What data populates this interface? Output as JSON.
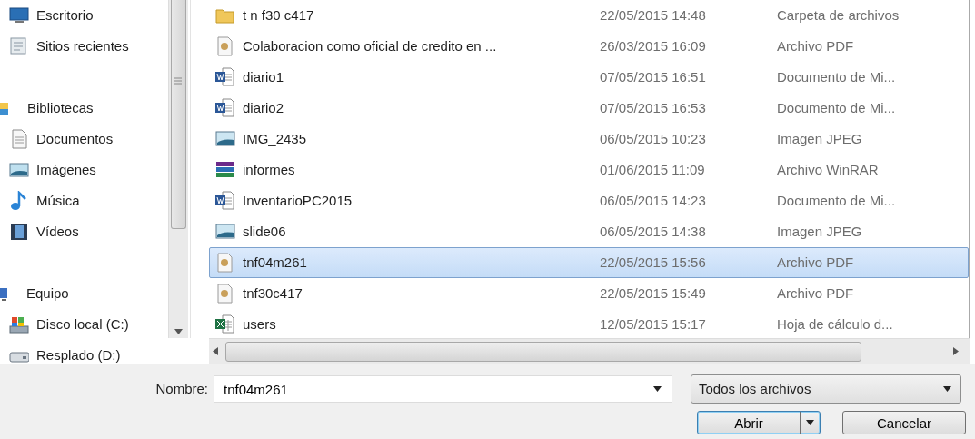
{
  "sidebar": {
    "groups": [
      {
        "children": [
          {
            "label": "Escritorio",
            "kind": "desktop"
          },
          {
            "label": "Sitios recientes",
            "kind": "recent"
          }
        ]
      },
      {
        "label": "Bibliotecas",
        "kind": "library",
        "children": [
          {
            "label": "Documentos",
            "kind": "documents"
          },
          {
            "label": "Imágenes",
            "kind": "pictures"
          },
          {
            "label": "Música",
            "kind": "music"
          },
          {
            "label": "Vídeos",
            "kind": "videos"
          }
        ]
      },
      {
        "label": "Equipo",
        "kind": "computer",
        "children": [
          {
            "label": "Disco local (C:)",
            "kind": "system"
          },
          {
            "label": "Resplado (D:)",
            "kind": "drive"
          }
        ]
      }
    ]
  },
  "files": {
    "rows": [
      {
        "name": "t n f30 c417",
        "date": "22/05/2015 14:48",
        "type": "Carpeta de archivos",
        "kind": "folder",
        "selected": false
      },
      {
        "name": "Colaboracion como oficial de credito en ...",
        "date": "26/03/2015 16:09",
        "type": "Archivo PDF",
        "kind": "pdf",
        "selected": false
      },
      {
        "name": "diario1",
        "date": "07/05/2015 16:51",
        "type": "Documento de Mi...",
        "kind": "word",
        "selected": false
      },
      {
        "name": "diario2",
        "date": "07/05/2015 16:53",
        "type": "Documento de Mi...",
        "kind": "word",
        "selected": false
      },
      {
        "name": "IMG_2435",
        "date": "06/05/2015 10:23",
        "type": "Imagen JPEG",
        "kind": "image",
        "selected": false
      },
      {
        "name": "informes",
        "date": "01/06/2015 11:09",
        "type": "Archivo WinRAR",
        "kind": "archive",
        "selected": false
      },
      {
        "name": "InventarioPC2015",
        "date": "06/05/2015 14:23",
        "type": "Documento de Mi...",
        "kind": "word",
        "selected": false
      },
      {
        "name": "slide06",
        "date": "06/05/2015 14:38",
        "type": "Imagen JPEG",
        "kind": "image",
        "selected": false
      },
      {
        "name": "tnf04m261",
        "date": "22/05/2015 15:56",
        "type": "Archivo PDF",
        "kind": "pdf",
        "selected": true
      },
      {
        "name": "tnf30c417",
        "date": "22/05/2015 15:49",
        "type": "Archivo PDF",
        "kind": "pdf",
        "selected": false
      },
      {
        "name": "users",
        "date": "12/05/2015 15:17",
        "type": "Hoja de cálculo d...",
        "kind": "excel",
        "selected": false
      }
    ]
  },
  "name_field": {
    "label": "Nombre:",
    "value": "tnf04m261"
  },
  "filter": {
    "value": "Todos los archivos"
  },
  "buttons": [
    {
      "label": "Abrir",
      "kind": "split",
      "focused": true
    },
    {
      "label": "Cancelar",
      "kind": "plain",
      "focused": false
    }
  ]
}
